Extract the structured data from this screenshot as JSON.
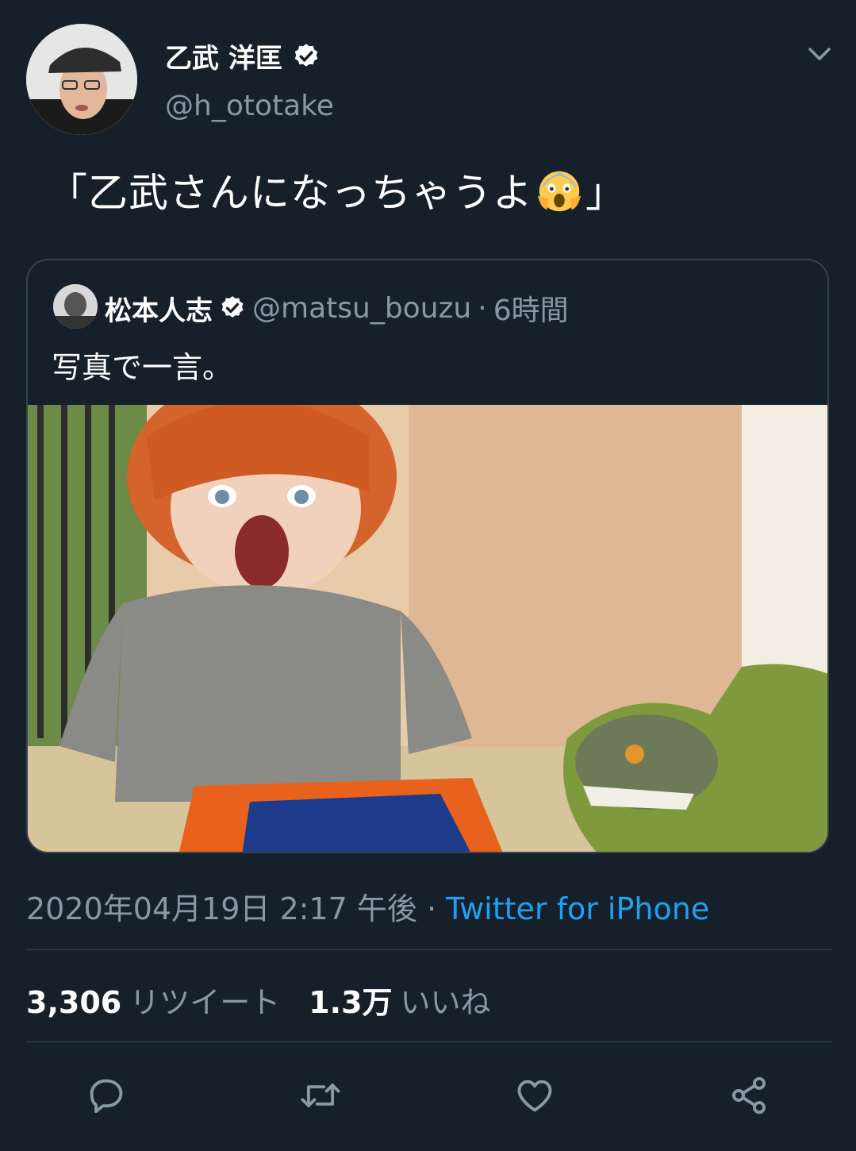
{
  "tweet": {
    "author_name": "乙武 洋匡",
    "author_handle": "@h_ototake",
    "text_before": "「乙武さんになっちゃうよ",
    "text_emoji": "face-screaming-in-fear-emoji",
    "text_after": "」",
    "timestamp": "2020年04月19日 2:17 午後",
    "separator": " · ",
    "source": "Twitter for iPhone"
  },
  "quote": {
    "name": "松本人志",
    "handle": "@matsu_bouzu",
    "separator": " · ",
    "time": "6時間",
    "text": "写真で一言。",
    "image_icon": "photo-child-screaming-with-toy-dinosaur"
  },
  "stats": {
    "retweets_count": "3,306",
    "retweets_label": "リツイート",
    "likes_count": "1.3万",
    "likes_label": "いいね"
  },
  "actions": [
    "reply-icon",
    "retweet-icon",
    "like-icon",
    "share-icon"
  ],
  "colors": {
    "background": "#15202b",
    "secondary_text": "#8899a6",
    "accent": "#1da1f2",
    "border": "#38444d"
  }
}
